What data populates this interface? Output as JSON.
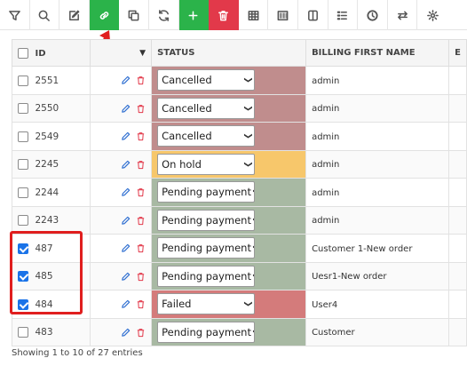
{
  "toolbar": {
    "buttons": [
      {
        "icon": "filter-icon"
      },
      {
        "icon": "search-icon"
      },
      {
        "icon": "edit-icon"
      },
      {
        "icon": "link-icon",
        "active": true
      },
      {
        "icon": "copy-icon"
      },
      {
        "icon": "refresh-icon"
      },
      {
        "icon": "plus-icon"
      },
      {
        "icon": "trash-icon"
      },
      {
        "icon": "table-icon"
      },
      {
        "icon": "barcode-icon"
      },
      {
        "icon": "columns-icon"
      },
      {
        "icon": "list-icon"
      },
      {
        "icon": "clock-icon"
      },
      {
        "icon": "swap-icon"
      },
      {
        "icon": "settings-icon"
      }
    ],
    "colors": {
      "green": "#2bb34a",
      "red": "#e2394a"
    }
  },
  "table": {
    "headers": {
      "id": "ID",
      "status": "STATUS",
      "billing": "BILLING FIRST NAME",
      "extra": "E"
    },
    "rows": [
      {
        "id": "2551",
        "checked": false,
        "status": "Cancelled",
        "status_color": "#c08d8d",
        "billing": "admin"
      },
      {
        "id": "2550",
        "checked": false,
        "status": "Cancelled",
        "status_color": "#c08d8d",
        "billing": "admin"
      },
      {
        "id": "2549",
        "checked": false,
        "status": "Cancelled",
        "status_color": "#c08d8d",
        "billing": "admin"
      },
      {
        "id": "2245",
        "checked": false,
        "status": "On hold",
        "status_color": "#f7c76b",
        "billing": "admin"
      },
      {
        "id": "2244",
        "checked": false,
        "status": "Pending payment",
        "status_color": "#a8b9a3",
        "billing": "admin"
      },
      {
        "id": "2243",
        "checked": false,
        "status": "Pending payment",
        "status_color": "#a8b9a3",
        "billing": "admin"
      },
      {
        "id": "487",
        "checked": true,
        "status": "Pending payment",
        "status_color": "#a8b9a3",
        "billing": "Customer 1-New order"
      },
      {
        "id": "485",
        "checked": true,
        "status": "Pending payment",
        "status_color": "#a8b9a3",
        "billing": "Uesr1-New order"
      },
      {
        "id": "484",
        "checked": true,
        "status": "Failed",
        "status_color": "#d47b7b",
        "billing": "User4"
      },
      {
        "id": "483",
        "checked": false,
        "status": "Pending payment",
        "status_color": "#a8b9a3",
        "billing": "Customer"
      }
    ]
  },
  "footer": {
    "text": "Showing 1 to 10 of 27 entries"
  }
}
